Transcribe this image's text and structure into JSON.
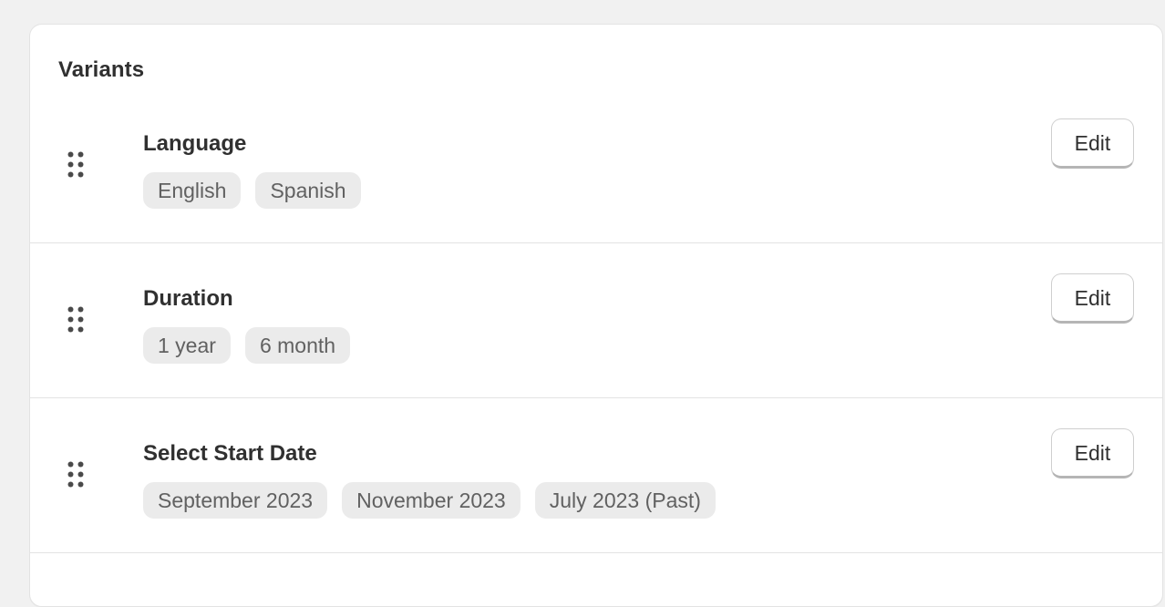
{
  "card": {
    "title": "Variants"
  },
  "options": [
    {
      "name": "Language",
      "values": [
        "English",
        "Spanish"
      ],
      "edit_label": "Edit"
    },
    {
      "name": "Duration",
      "values": [
        "1 year",
        "6 month"
      ],
      "edit_label": "Edit"
    },
    {
      "name": "Select Start Date",
      "values": [
        "September 2023",
        "November 2023",
        "July 2023 (Past)"
      ],
      "edit_label": "Edit"
    }
  ],
  "icons": {
    "drag_handle": "drag-handle-icon"
  },
  "colors": {
    "page_background": "#f1f1f1",
    "card_background": "#ffffff",
    "chip_background": "#ebebeb",
    "text_primary": "#303030",
    "text_chip": "#616161"
  }
}
